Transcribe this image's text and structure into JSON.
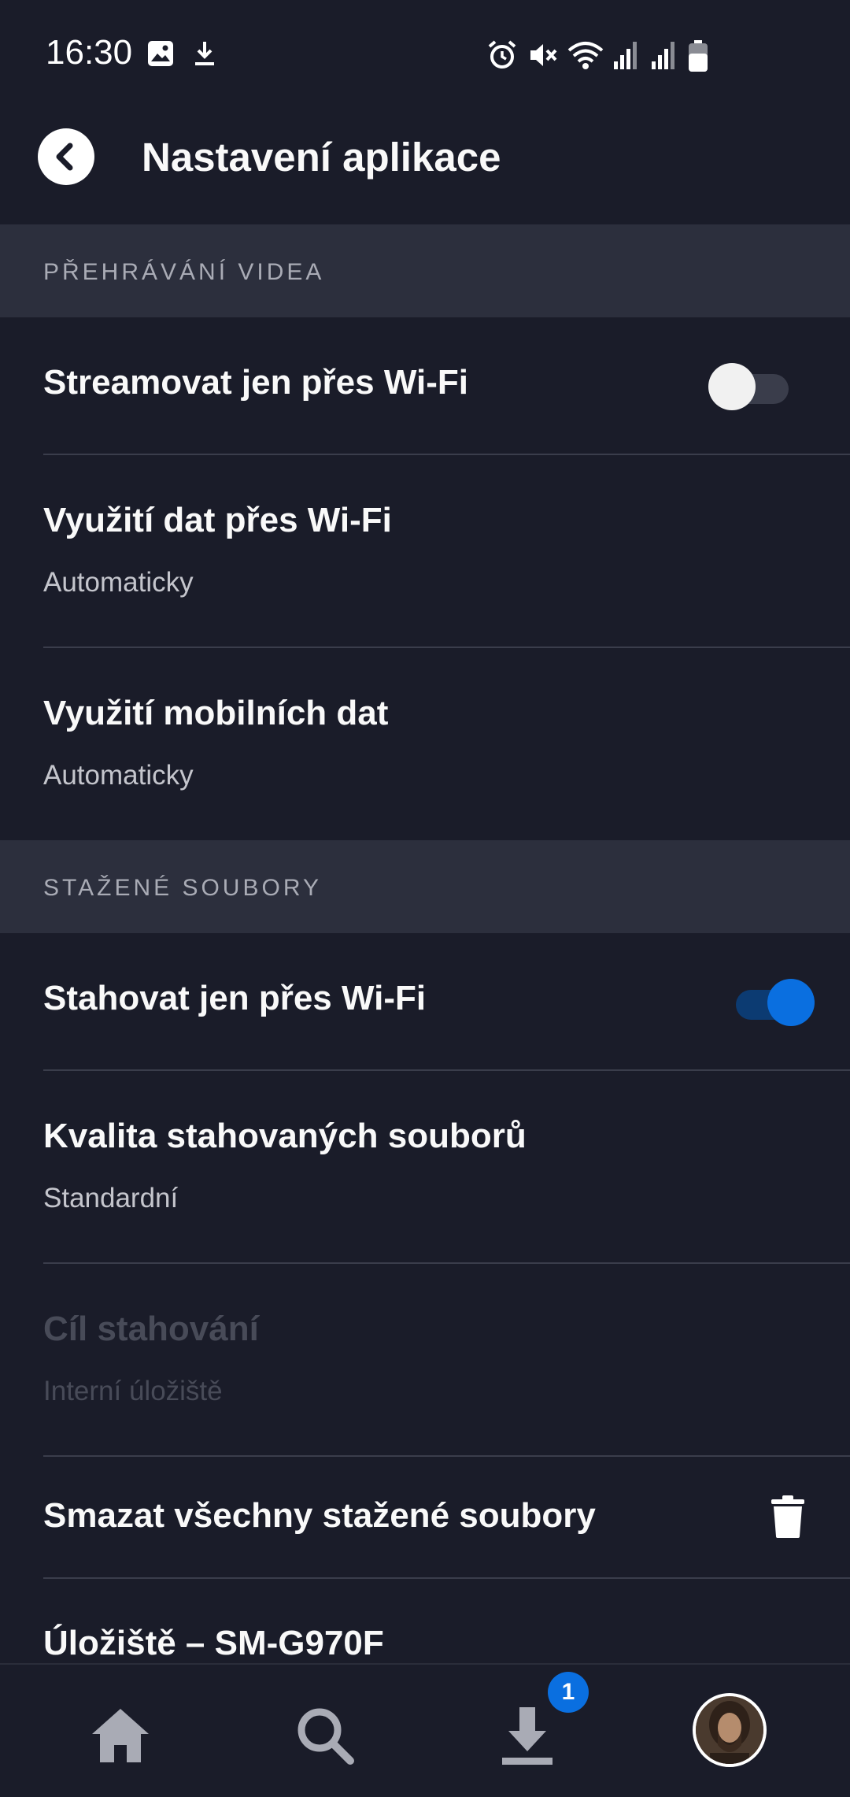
{
  "status_bar": {
    "time": "16:30",
    "icons_left": [
      "image-icon",
      "download-icon"
    ],
    "icons_right": [
      "alarm-icon",
      "mute-icon",
      "wifi-icon",
      "signal-icon",
      "signal-icon",
      "battery-icon"
    ]
  },
  "app_bar": {
    "title": "Nastavení aplikace",
    "back_icon": "chevron-left-icon"
  },
  "sections": {
    "video": {
      "header": "PŘEHRÁVÁNÍ VIDEA",
      "stream_wifi": {
        "title": "Streamovat jen přes Wi-Fi",
        "toggle_on": false
      },
      "wifi_data": {
        "title": "Využití dat přes Wi-Fi",
        "value": "Automaticky"
      },
      "mobile_data": {
        "title": "Využití mobilních dat",
        "value": "Automaticky"
      }
    },
    "downloads": {
      "header": "STAŽENÉ SOUBORY",
      "download_wifi": {
        "title": "Stahovat jen přes Wi-Fi",
        "toggle_on": true
      },
      "quality": {
        "title": "Kvalita stahovaných souborů",
        "value": "Standardní"
      },
      "destination": {
        "title": "Cíl stahování",
        "value": "Interní úložiště",
        "disabled": true
      },
      "delete_all": {
        "title": "Smazat všechny stažené soubory",
        "icon": "trash-icon"
      },
      "storage": {
        "title": "Úložiště – SM-G970F"
      }
    }
  },
  "bottom_nav": {
    "items": [
      "home-icon",
      "search-icon",
      "download-icon",
      "avatar"
    ],
    "downloads_badge": "1"
  },
  "colors": {
    "background": "#1a1c29",
    "section_header": "#2c2f3d",
    "accent": "#0a6fe0"
  }
}
